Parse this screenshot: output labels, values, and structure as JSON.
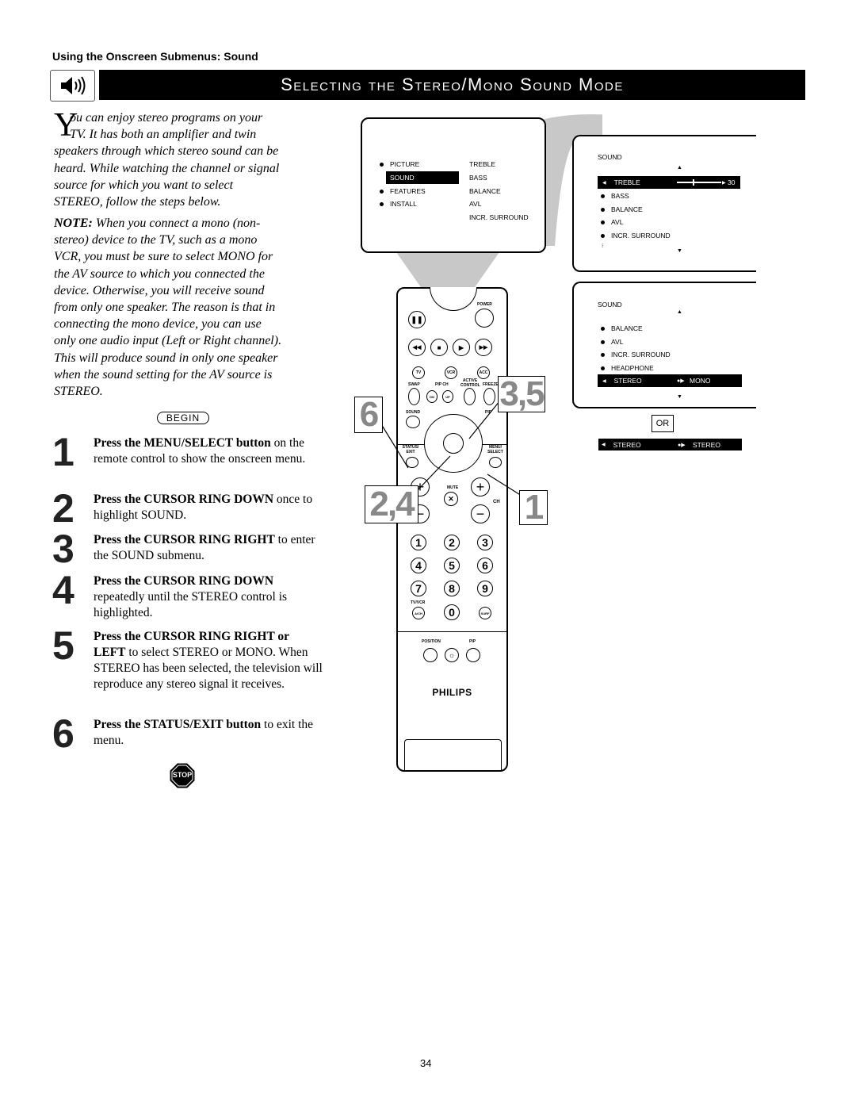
{
  "section_title": "Using the Onscreen Submenus: Sound",
  "page_title": "Selecting the Stereo/Mono Sound Mode",
  "intro": {
    "dropcap": "Y",
    "lines": [
      "ou can enjoy stereo programs on your",
      "TV. It has both an amplifier and twin",
      "speakers through which stereo sound can be",
      "heard. While watching the channel or signal",
      "source for which you want to select",
      "STEREO, follow the steps below."
    ]
  },
  "note": {
    "label": "NOTE:",
    "lines": [
      " When you connect a mono (non-",
      "stereo) device to the TV, such as a mono",
      "VCR, you must be sure to select MONO for",
      "the AV source to which you connected the",
      "device. Otherwise, you will receive sound",
      "from only one speaker. The reason is that in",
      "connecting the mono device, you can use",
      "only one audio input (Left or Right channel).",
      "This will produce sound in only one speaker",
      "when the sound setting for the AV source is",
      "STEREO."
    ]
  },
  "begin_label": "BEGIN",
  "steps": [
    {
      "num": "1",
      "bold": "Press the MENU/SELECT button",
      "text": " on the remote control to show the onscreen menu."
    },
    {
      "num": "2",
      "bold": "Press the CURSOR RING DOWN",
      "text": " once to highlight SOUND."
    },
    {
      "num": "3",
      "bold": "Press the CURSOR RING RIGHT",
      "text": " to enter the SOUND submenu."
    },
    {
      "num": "4",
      "bold": "Press the CURSOR RING DOWN",
      "text": " repeatedly until the STEREO control is highlighted."
    },
    {
      "num": "5",
      "bold": "Press the CURSOR RING RIGHT or LEFT",
      "text": " to select STEREO or MONO. When STEREO has been selected, the television will reproduce any stereo signal it receives."
    },
    {
      "num": "6",
      "bold": "Press the STATUS/EXIT button",
      "text": " to exit the menu."
    }
  ],
  "stop_label": "STOP",
  "main_menu": {
    "left": [
      "PICTURE",
      "SOUND",
      "FEATURES",
      "INSTALL"
    ],
    "right": [
      "TREBLE",
      "BASS",
      "BALANCE",
      "AVL",
      "INCR. SURROUND"
    ],
    "selected": "SOUND"
  },
  "sound_menu_1": {
    "title": "SOUND",
    "items": [
      "TREBLE",
      "BASS",
      "BALANCE",
      "AVL",
      "INCR. SURROUND"
    ],
    "selected": "TREBLE",
    "treble_value": "30"
  },
  "sound_menu_2": {
    "title": "SOUND",
    "items": [
      "BALANCE",
      "AVL",
      "INCR. SURROUND",
      "HEADPHONE",
      "STEREO"
    ],
    "selected": "STEREO",
    "stereo_value": "MONO"
  },
  "or_label": "OR",
  "alt_bar": {
    "label": "STEREO",
    "value": "STEREO"
  },
  "callouts": [
    "6",
    "3,5",
    "2,4",
    "1"
  ],
  "remote": {
    "power": "POWER",
    "tv": "TV",
    "vcr": "VCR",
    "acc": "ACC",
    "swap": "SWAP",
    "pipch": "PIP CH",
    "active": "ACTIVE CONTROL",
    "freeze": "FREEZE",
    "dn": "DN",
    "up": "UP",
    "sound": "SOUND",
    "pip": "PIP",
    "status": "STATUS/ EXIT",
    "menu": "MENU/ SELECT",
    "mute": "MUTE",
    "ch": "CH",
    "digits": [
      "1",
      "2",
      "3",
      "4",
      "5",
      "6",
      "7",
      "8",
      "9",
      "0"
    ],
    "tvvcr": "TV/VCR",
    "ach": "A/CH",
    "surf": "SURF",
    "position": "POSITION",
    "pip2": "PIP",
    "brand": "PHILIPS"
  },
  "page_number": "34"
}
